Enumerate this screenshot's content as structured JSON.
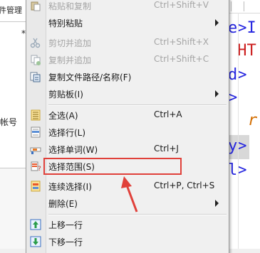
{
  "left_panel": {
    "tab_text": "件管理",
    "star": "*",
    "account_label": "帐号"
  },
  "editor": {
    "lines": [
      {
        "text": "e>I",
        "color": "blue"
      },
      {
        "text": " HT",
        "color": "red"
      },
      {
        "text": "d>",
        "color": "blue"
      },
      {
        "text": ">",
        "color": "blue"
      },
      {
        "text": "r",
        "color": "orange"
      },
      {
        "text": "y>",
        "color": "blue"
      },
      {
        "text": "l>",
        "color": "blue"
      }
    ]
  },
  "context_menu": {
    "items": [
      {
        "label": "粘贴和复制",
        "shortcut": "Ctrl+Shift+V",
        "icon": "paste-copy-icon",
        "disabled": true
      },
      {
        "label": "特别粘贴",
        "shortcut": "",
        "icon": "",
        "submenu": true
      },
      {
        "label": "剪切并追加",
        "shortcut": "Ctrl+Shift+X",
        "icon": "cut-append-icon",
        "disabled": true
      },
      {
        "label": "复制并追加",
        "shortcut": "Ctrl+Shift+C",
        "icon": "copy-append-icon",
        "disabled": true
      },
      {
        "label": "复制文件路径/名称(F)",
        "shortcut": "",
        "icon": "copy-path-icon"
      },
      {
        "label": "剪贴板(I)",
        "shortcut": "",
        "icon": "",
        "submenu": true
      },
      {
        "label": "全选(A)",
        "shortcut": "Ctrl+A",
        "icon": "select-all-icon"
      },
      {
        "label": "选择行(L)",
        "shortcut": "",
        "icon": "select-line-icon"
      },
      {
        "label": "选择单词(W)",
        "shortcut": "Ctrl+J",
        "icon": "select-word-icon"
      },
      {
        "label": "选择范围(S)",
        "shortcut": "",
        "icon": "select-range-icon"
      },
      {
        "label": "连续选择(I)",
        "shortcut": "Ctrl+P, Ctrl+S",
        "icon": "continuous-select-icon"
      },
      {
        "label": "删除(E)",
        "shortcut": "",
        "icon": "",
        "submenu": true
      },
      {
        "label": "上移一行",
        "shortcut": "",
        "icon": "move-line-up-icon"
      },
      {
        "label": "下移一行",
        "shortcut": "",
        "icon": "move-line-down-icon"
      }
    ]
  },
  "annotation": {
    "color": "#e0403a"
  }
}
